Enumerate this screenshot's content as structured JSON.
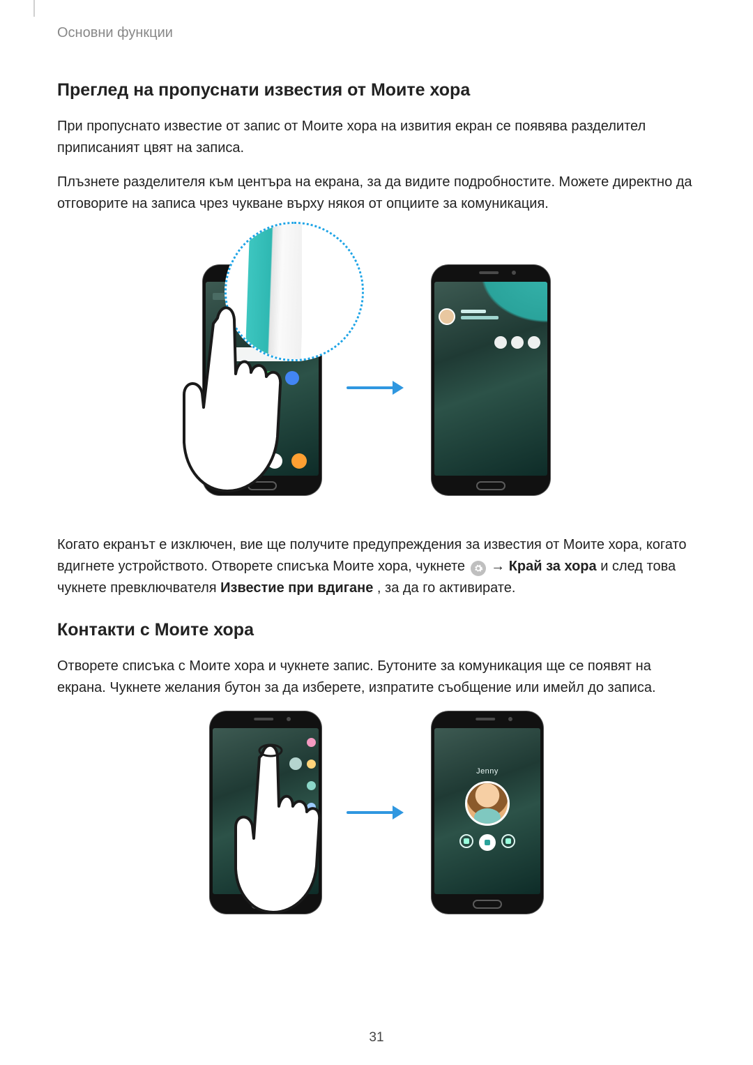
{
  "breadcrumb": "Основни функции",
  "section1": {
    "title": "Преглед на пропуснати известия от Моите хора",
    "p1": "При пропуснато известие от запис от Моите хора на извития екран се появява разделител приписаният цвят на записа.",
    "p2": "Плъзнете разделителя към центъра на екрана, за да видите подробностите. Можете директно да отговорите на записа чрез чукване върху някоя от опциите за комуникация.",
    "p3_a": "Когато екранът е изключен, вие ще получите предупреждения за известия от Моите хора, когато вдигнете устройството. Отворете списъка Моите хора, чукнете ",
    "p3_arrow": " → ",
    "p3_bold1": "Край за хора",
    "p3_b": " и след това чукнете превключвателя ",
    "p3_bold2": "Известие при вдигане",
    "p3_c": ", за да го активирате."
  },
  "section2": {
    "title": "Контакти с Моите хора",
    "p1": "Отворете списъка с Моите хора и чукнете запис. Бутоните за комуникация ще се появят на екрана. Чукнете желания бутон за да изберете, изпратите съобщение или имейл до записа."
  },
  "contact_panel": {
    "name": "Jenny"
  },
  "page_number": "31"
}
